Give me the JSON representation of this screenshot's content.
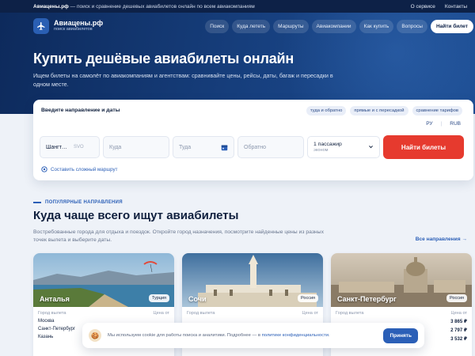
{
  "topbar": {
    "site": "Авиацены.рф",
    "tagline": " — поиск и сравнение дешевых авиабилетов онлайн по всем авиакомпаниям",
    "links": [
      "О сервисе",
      "Контакты"
    ]
  },
  "brand": {
    "name": "Авиацены.рф",
    "sub": "поиск авиабилетов"
  },
  "nav": {
    "items": [
      "Поиск",
      "Куда лететь",
      "Маршруты",
      "Авиакомпании",
      "Как купить",
      "Вопросы"
    ],
    "cta": "Найти билет"
  },
  "hero": {
    "title": "Купить дешёвые авиабилеты онлайн",
    "lead": "Ищем билеты на самолёт по авиакомпаниям и агентствам: сравнивайте цены, рейсы, даты, багаж и пересадки в одном месте."
  },
  "search": {
    "title": "Введите направление и даты",
    "chips": [
      "туда и обратно",
      "прямые и с пересадкой",
      "сравнение тарифов"
    ],
    "currencies": [
      "РУ",
      "RUB"
    ],
    "from_value": "Шангт…",
    "from_code": "SVO",
    "to_placeholder": "Куда",
    "depart_placeholder": "Туда",
    "return_placeholder": "Обратно",
    "passengers": "1 пассажир",
    "cabin": "эконом",
    "submit": "Найти билеты",
    "complex_route": "Составить сложный маршрут"
  },
  "popular": {
    "eyebrow": "ПОПУЛЯРНЫЕ НАПРАВЛЕНИЯ",
    "title": "Куда чаще всего ищут авиабилеты",
    "description": "Востребованные города для отдыха и поездок. Откройте город назначения, посмотрите найденные цены из разных точек вылета и выберите даты.",
    "all_link": "Все направления →",
    "col_from": "Город вылета",
    "col_price": "Цена от",
    "cards": [
      {
        "city": "Анталья",
        "country": "Турция",
        "rows": [
          {
            "from": "Москва",
            "price": ""
          },
          {
            "from": "Санкт-Петербург",
            "price": ""
          },
          {
            "from": "Казань",
            "price": ""
          }
        ]
      },
      {
        "city": "Сочи",
        "country": "Россия",
        "rows": []
      },
      {
        "city": "Санкт-Петербург",
        "country": "Россия",
        "rows": [
          {
            "from": "",
            "price": "3 865 ₽"
          },
          {
            "from": "",
            "price": "2 797 ₽"
          },
          {
            "from": "",
            "price": "3 532 ₽"
          }
        ]
      }
    ]
  },
  "cookie": {
    "text": "Мы используем cookie для работы поиска и аналитики. Подробнее — в ",
    "link": "политике конфиденциальности",
    "tail": ".",
    "accept": "Принять"
  }
}
